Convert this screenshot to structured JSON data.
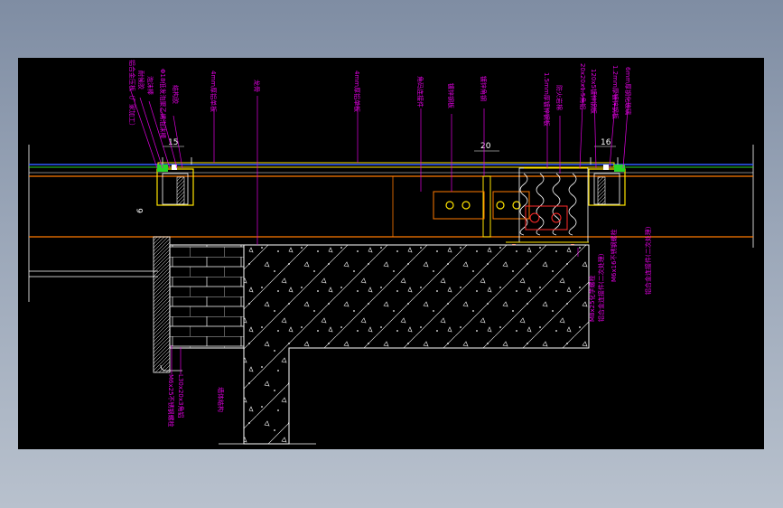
{
  "viewport": {
    "background": "#000000",
    "frame_bg": "#8e9bb0"
  },
  "colors": {
    "magenta": "#e200e2",
    "yellow": "#ffe400",
    "orange": "#ff7a00",
    "white": "#ffffff",
    "green": "#27d627",
    "blue": "#2f5cff",
    "red": "#ff2a2a"
  },
  "dimensions": {
    "left": "15",
    "center": "20",
    "right": "16",
    "vertical": "6"
  },
  "labels_top": [
    "铝合金压板（厂家加工）",
    "耐候胶",
    "泡沫棒",
    "Φ18低发泡聚乙烯泡沫棒",
    "结构胶",
    "4mm厚铝单板",
    "龙骨",
    "4mm厚铝单板",
    "角码连接件",
    "镀锌钢板",
    "镀锌角钢",
    "1.5mm厚镀锌钢板",
    "防火岩棉",
    "20x20x1.5角铝",
    "120x5镀锌钢板",
    "1.2mm厚镀锌钢板",
    "6mm厚钢化玻璃"
  ],
  "labels_bottom_left": [
    "M6x25不锈钢螺栓",
    "L30x20x3角铝"
  ],
  "labels_bottom_mid": [
    "M8x25化学螺栓",
    "铝合金连接件(二次处理)"
  ],
  "labels_bottom_right": [
    "M6x16不锈钢螺栓",
    "铝合金连接件(二次处理)"
  ],
  "label_wall": "墙体结构"
}
